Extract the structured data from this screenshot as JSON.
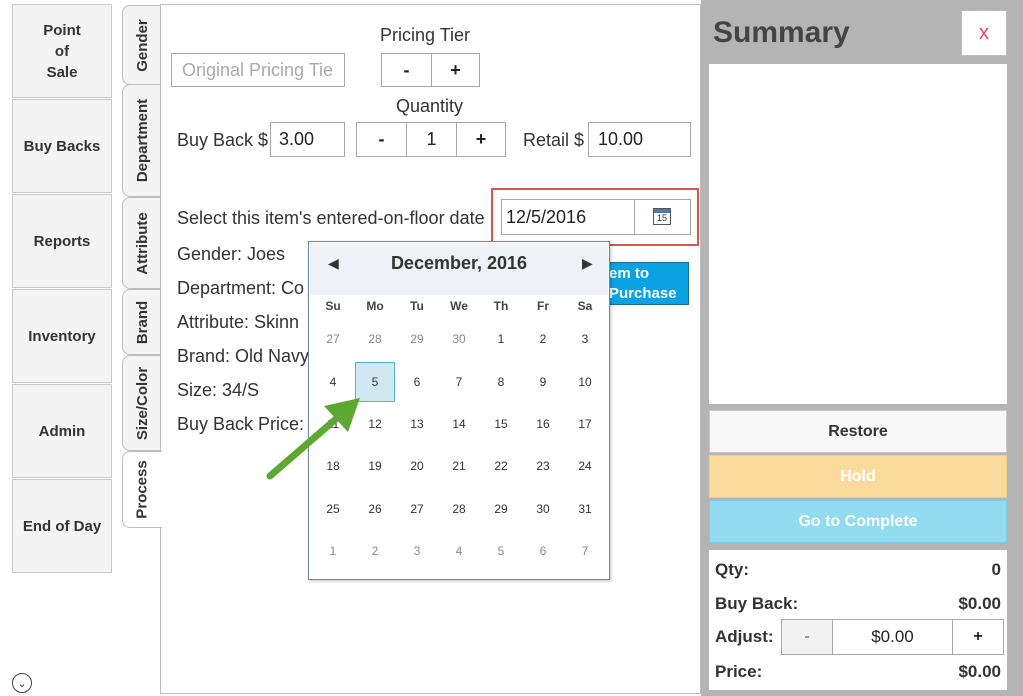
{
  "nav": {
    "items": [
      {
        "label": "Point\nof\nSale"
      },
      {
        "label": "Buy Backs"
      },
      {
        "label": "Reports"
      },
      {
        "label": "Inventory"
      },
      {
        "label": "Admin"
      },
      {
        "label": "End of Day"
      }
    ]
  },
  "tabs": [
    "Gender",
    "Department",
    "Attribute",
    "Brand",
    "Size/Color",
    "Process"
  ],
  "form": {
    "original_pricing_tier_placeholder": "Original Pricing Tie",
    "pricing_tier_label": "Pricing Tier",
    "quantity_label": "Quantity",
    "buyback_label": "Buy Back $",
    "buyback_value": "3.00",
    "quantity_value": "1",
    "retail_label": "Retail $",
    "retail_value": "10.00",
    "minus": "-",
    "plus": "+",
    "date_prompt": "Select this item's entered-on-floor date",
    "date_value": "12/5/2016",
    "calendar_icon_day": "15",
    "gender": "Gender:  Joes",
    "department": "Department:  Co",
    "attribute": "Attribute:  Skinn",
    "brand": "Brand:  Old Navy",
    "size": "Size:  34/S",
    "buyback_price": "Buy Back Price:",
    "add_button_line1": "em to",
    "add_button_line2": "Purchase"
  },
  "calendar": {
    "title": "December, 2016",
    "weekdays": [
      "Su",
      "Mo",
      "Tu",
      "We",
      "Th",
      "Fr",
      "Sa"
    ],
    "weeks": [
      [
        {
          "d": "27",
          "o": true
        },
        {
          "d": "28",
          "o": true
        },
        {
          "d": "29",
          "o": true
        },
        {
          "d": "30",
          "o": true
        },
        {
          "d": "1"
        },
        {
          "d": "2"
        },
        {
          "d": "3"
        }
      ],
      [
        {
          "d": "4"
        },
        {
          "d": "5",
          "s": true
        },
        {
          "d": "6"
        },
        {
          "d": "7"
        },
        {
          "d": "8"
        },
        {
          "d": "9"
        },
        {
          "d": "10"
        }
      ],
      [
        {
          "d": "11"
        },
        {
          "d": "12"
        },
        {
          "d": "13"
        },
        {
          "d": "14"
        },
        {
          "d": "15"
        },
        {
          "d": "16"
        },
        {
          "d": "17"
        }
      ],
      [
        {
          "d": "18"
        },
        {
          "d": "19"
        },
        {
          "d": "20"
        },
        {
          "d": "21"
        },
        {
          "d": "22"
        },
        {
          "d": "23"
        },
        {
          "d": "24"
        }
      ],
      [
        {
          "d": "25"
        },
        {
          "d": "26"
        },
        {
          "d": "27"
        },
        {
          "d": "28"
        },
        {
          "d": "29"
        },
        {
          "d": "30"
        },
        {
          "d": "31"
        }
      ],
      [
        {
          "d": "1",
          "o": true
        },
        {
          "d": "2",
          "o": true
        },
        {
          "d": "3",
          "o": true
        },
        {
          "d": "4",
          "o": true
        },
        {
          "d": "5",
          "o": true
        },
        {
          "d": "6",
          "o": true
        },
        {
          "d": "7",
          "o": true
        }
      ]
    ]
  },
  "summary": {
    "title": "Summary",
    "close": "x",
    "restore": "Restore",
    "hold": "Hold",
    "complete": "Go to Complete",
    "qty_label": "Qty:",
    "qty_value": "0",
    "buyback_label": "Buy Back:",
    "buyback_value": "$0.00",
    "adjust_label": "Adjust:",
    "adjust_value": "$0.00",
    "adjust_minus": "-",
    "adjust_plus": "+",
    "price_label": "Price:",
    "price_value": "$0.00"
  },
  "colors": {
    "accent_blue": "#0aa2e3",
    "hold": "#fbdb9c",
    "complete": "#92dbf0",
    "highlight": "#d9534f",
    "arrow": "#5da832"
  }
}
